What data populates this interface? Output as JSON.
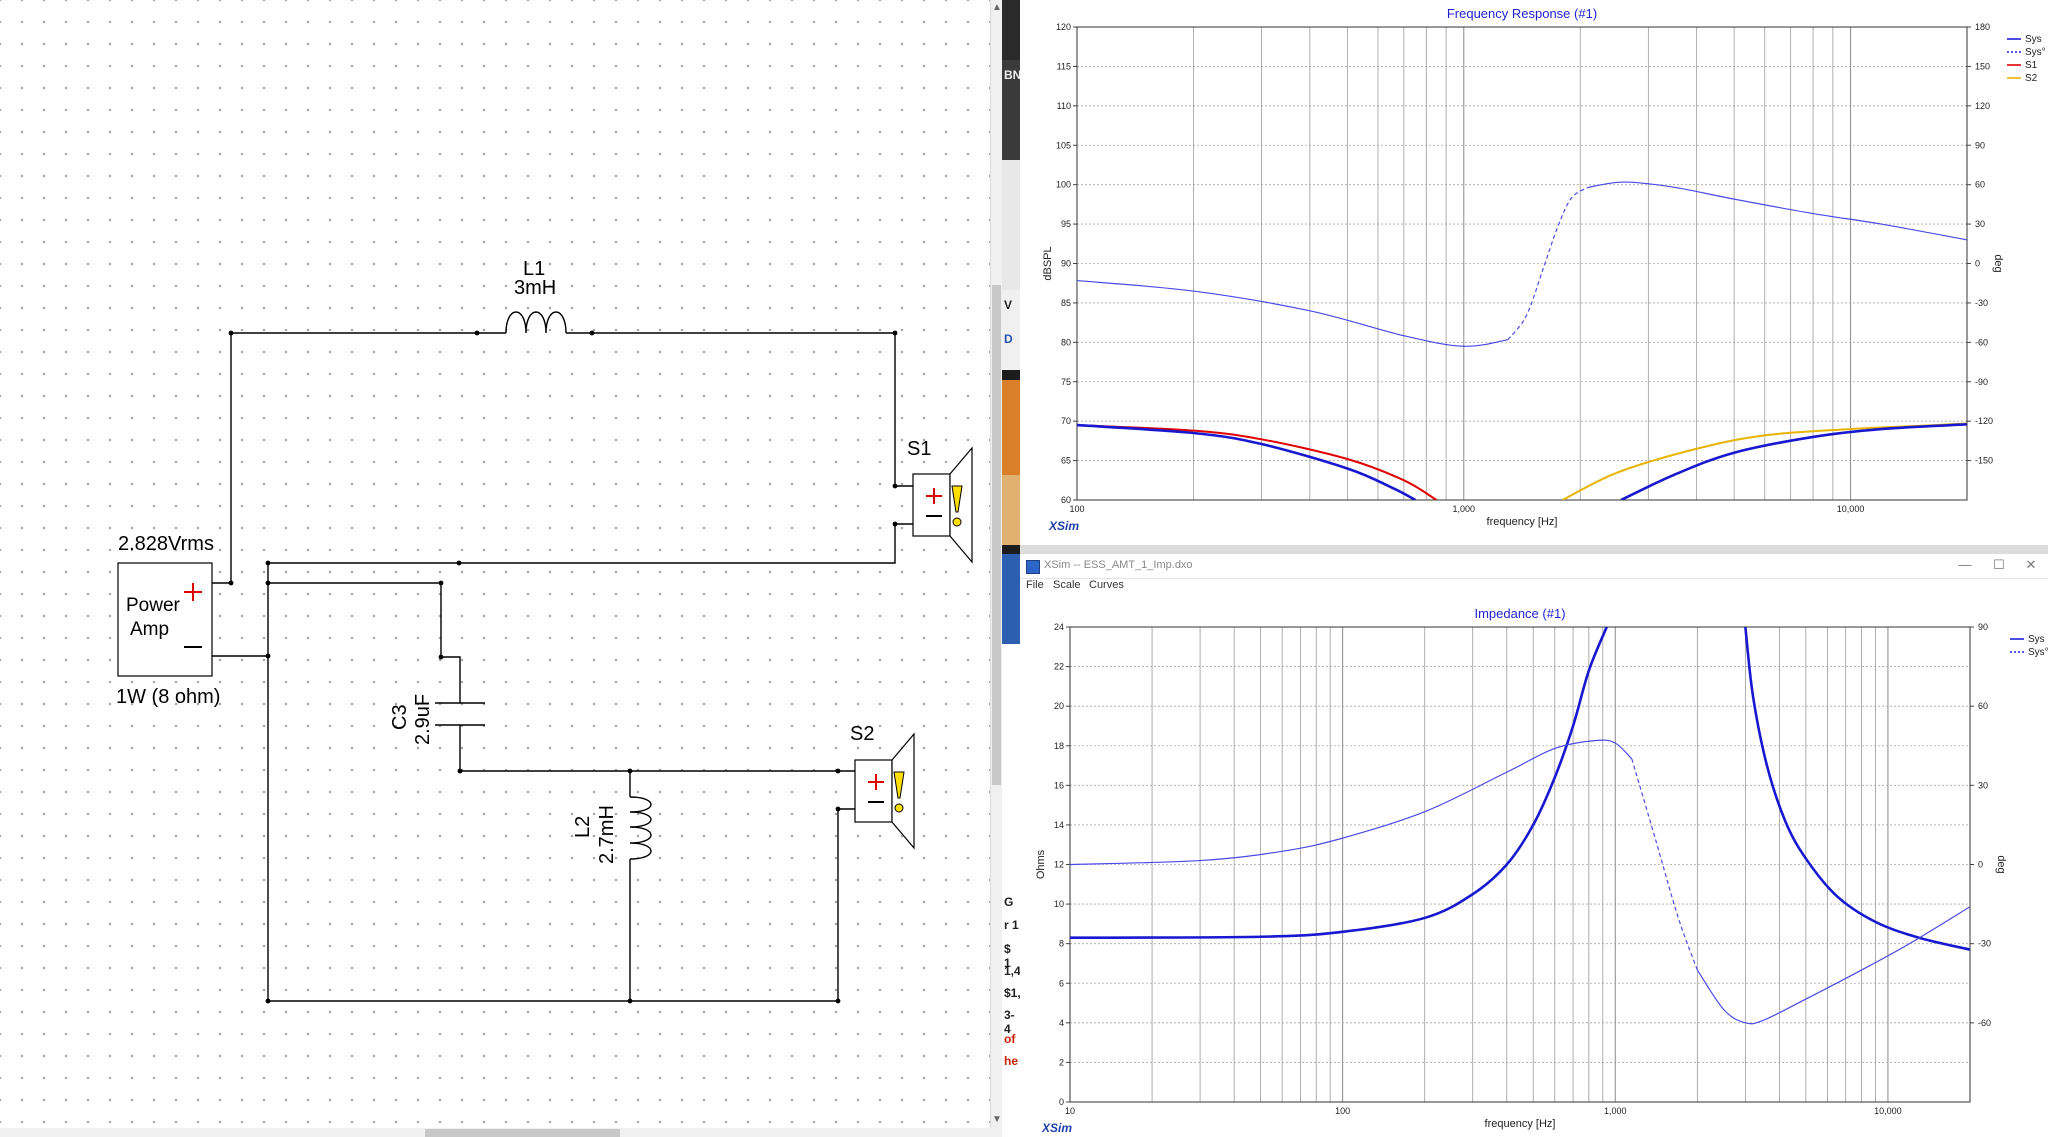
{
  "schematic": {
    "source_voltage": "2.828Vrms",
    "amp_line1": "Power",
    "amp_line2": "Amp",
    "amp_rating": "1W (8 ohm)",
    "plus_sign": "+",
    "minus_sign": "—",
    "components": {
      "L1": {
        "name": "L1",
        "value": "3mH"
      },
      "C3": {
        "name": "C3",
        "value": "2.9uF"
      },
      "L2": {
        "name": "L2",
        "value": "2.7mH"
      },
      "S1": {
        "name": "S1"
      },
      "S2": {
        "name": "S2"
      }
    }
  },
  "window_bottom": {
    "title": "XSim -- ESS_AMT_1_Imp.dxo",
    "menu": [
      "File",
      "Scale",
      "Curves"
    ],
    "controls": {
      "minimize": "—",
      "maximize": "☐",
      "close": "✕"
    }
  },
  "left_strip_fragments": [
    "BN",
    "V",
    "D",
    "G",
    "r 1",
    "$ 1",
    "1,4",
    "$1,",
    "3-4",
    "of",
    "he"
  ],
  "branding": "XSim",
  "chart_data": [
    {
      "type": "line",
      "title": "Frequency Response (#1)",
      "xlabel": "frequency [Hz]",
      "ylabel": "dBSPL",
      "y2label": "deg",
      "xscale": "log",
      "xlim": [
        100,
        20000
      ],
      "ylim": [
        60,
        120
      ],
      "y2lim": [
        -180,
        180
      ],
      "xticks": [
        {
          "v": 100,
          "t": "100"
        },
        {
          "v": 1000,
          "t": "1,000"
        },
        {
          "v": 10000,
          "t": "10,000"
        }
      ],
      "yticks": [
        60,
        65,
        70,
        75,
        80,
        85,
        90,
        95,
        100,
        105,
        110,
        115,
        120
      ],
      "y2ticks": [
        -150,
        -120,
        -90,
        -60,
        -30,
        0,
        30,
        60,
        90,
        120,
        150,
        180
      ],
      "legend_position": "top-right",
      "legend": [
        {
          "name": "Sys",
          "color": "#2222dd",
          "dash": false
        },
        {
          "name": "Sys°",
          "color": "#2222dd",
          "dash": true
        },
        {
          "name": "S1",
          "color": "#e00000",
          "dash": false
        },
        {
          "name": "S2",
          "color": "#e8b400",
          "dash": false
        }
      ],
      "series": [
        {
          "name": "S1",
          "axis": "y",
          "color": "#e00000",
          "width": 2,
          "x": [
            100,
            200,
            300,
            500,
            700,
            850
          ],
          "y": [
            69.5,
            68.8,
            67.7,
            65.2,
            62.5,
            60
          ]
        },
        {
          "name": "S2",
          "axis": "y",
          "color": "#e8b400",
          "width": 2,
          "x": [
            1800,
            2500,
            4000,
            6000,
            10000,
            15000,
            20000
          ],
          "y": [
            60,
            63.5,
            66.5,
            68.2,
            69.0,
            69.4,
            69.7
          ]
        },
        {
          "name": "Sys",
          "axis": "y",
          "color": "#1818d0",
          "width": 2.6,
          "x": [
            100,
            200,
            300,
            500,
            650,
            750
          ],
          "y": [
            69.5,
            68.5,
            67.1,
            64.0,
            61.6,
            60
          ]
        },
        {
          "name": "Sys",
          "axis": "y",
          "color": "#1818d0",
          "width": 2.6,
          "x": [
            2550,
            3500,
            5000,
            8000,
            12000,
            20000
          ],
          "y": [
            60,
            63.2,
            66.0,
            68.0,
            69.0,
            69.6
          ]
        },
        {
          "name": "Sys°",
          "axis": "y2",
          "color": "#4a4ae8",
          "width": 1.2,
          "x": [
            100,
            200,
            400,
            700,
            1000,
            1300
          ],
          "y": [
            -13,
            -21,
            -36,
            -55,
            -63,
            -58
          ]
        },
        {
          "name": "Sys°",
          "axis": "y2",
          "color": "#4a4ae8",
          "width": 1.2,
          "dash": true,
          "x": [
            1300,
            1450,
            1600,
            1750,
            1900,
            2100
          ],
          "y": [
            -58,
            -40,
            -5,
            28,
            50,
            58
          ]
        },
        {
          "name": "Sys°",
          "axis": "y2",
          "color": "#4a4ae8",
          "width": 1.2,
          "x": [
            2100,
            2600,
            3500,
            5000,
            8000,
            12000,
            20000
          ],
          "y": [
            58,
            62,
            58,
            49,
            38,
            30,
            18
          ]
        }
      ]
    },
    {
      "type": "line",
      "title": "Impedance (#1)",
      "xlabel": "frequency [Hz]",
      "ylabel": "Ohms",
      "y2label": "deg",
      "xscale": "log",
      "xlim": [
        10,
        20000
      ],
      "ylim": [
        0,
        24
      ],
      "y2lim": [
        -90,
        90
      ],
      "xticks": [
        {
          "v": 10,
          "t": "10"
        },
        {
          "v": 100,
          "t": "100"
        },
        {
          "v": 1000,
          "t": "1,000"
        },
        {
          "v": 10000,
          "t": "10,000"
        }
      ],
      "yticks": [
        0,
        2,
        4,
        6,
        8,
        10,
        12,
        14,
        16,
        18,
        20,
        22,
        24
      ],
      "y2ticks": [
        -60,
        -30,
        0,
        30,
        60,
        90
      ],
      "legend_position": "top-right",
      "legend": [
        {
          "name": "Sys",
          "color": "#2222dd",
          "dash": false
        },
        {
          "name": "Sys°",
          "color": "#2222dd",
          "dash": true
        }
      ],
      "series": [
        {
          "name": "Sys",
          "axis": "y",
          "color": "#1818d0",
          "width": 2.6,
          "x": [
            10,
            50,
            100,
            200,
            300,
            400,
            500,
            600,
            700,
            800,
            930
          ],
          "y": [
            8.3,
            8.35,
            8.6,
            9.3,
            10.5,
            12.0,
            14.0,
            16.4,
            19.0,
            21.8,
            24
          ]
        },
        {
          "name": "Sys",
          "axis": "y",
          "color": "#1818d0",
          "width": 2.6,
          "x": [
            3000,
            3200,
            3600,
            4200,
            5000,
            6500,
            9000,
            13000,
            20000
          ],
          "y": [
            24,
            20.5,
            17.0,
            14.2,
            12.3,
            10.4,
            9.1,
            8.3,
            7.7
          ]
        },
        {
          "name": "Sys°",
          "axis": "y2",
          "color": "#4a4ae8",
          "width": 1.2,
          "x": [
            10,
            30,
            60,
            100,
            200,
            400,
            600,
            850,
            1000,
            1150
          ],
          "y": [
            0,
            1.5,
            5,
            10,
            20,
            35,
            44,
            47,
            46,
            40
          ]
        },
        {
          "name": "Sys°",
          "axis": "y2",
          "color": "#4a4ae8",
          "width": 1.2,
          "dash": true,
          "x": [
            1150,
            1400,
            1700,
            2000
          ],
          "y": [
            40,
            10,
            -20,
            -40
          ]
        },
        {
          "name": "Sys°",
          "axis": "y2",
          "color": "#4a4ae8",
          "width": 1.2,
          "x": [
            2000,
            2500,
            3000,
            3500,
            5000,
            8000,
            12000,
            20000
          ],
          "y": [
            -40,
            -55,
            -60,
            -59,
            -51,
            -40,
            -30,
            -16
          ]
        }
      ]
    }
  ]
}
